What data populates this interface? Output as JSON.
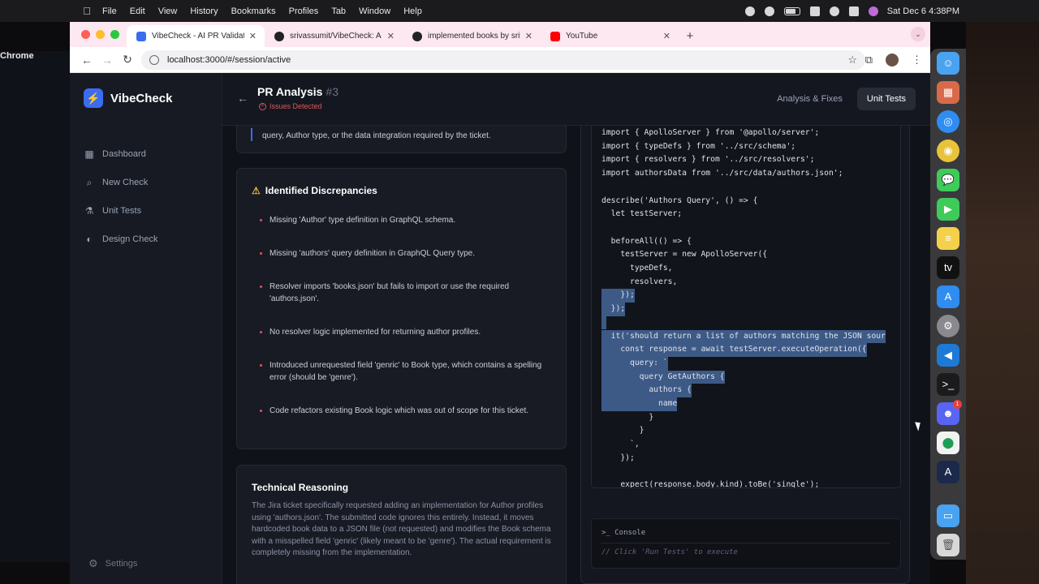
{
  "menubar": {
    "items": [
      "Chrome",
      "File",
      "Edit",
      "View",
      "History",
      "Bookmarks",
      "Profiles",
      "Tab",
      "Window",
      "Help"
    ],
    "clock": "Sat Dec 6  4:38PM"
  },
  "browser": {
    "tabs": [
      {
        "title": "VibeCheck - AI PR Validator",
        "favicon_color": "#3b6cf0"
      },
      {
        "title": "srivassumit/VibeCheck: A \"vib",
        "favicon_color": "#222222"
      },
      {
        "title": "implemented books by srivas",
        "favicon_color": "#222222"
      },
      {
        "title": "YouTube",
        "favicon_color": "#ff0000"
      }
    ],
    "url": "localhost:3000/#/session/active"
  },
  "sidebar": {
    "brand": "VibeCheck",
    "items": [
      {
        "label": "Dashboard",
        "icon": "grid-icon"
      },
      {
        "label": "New Check",
        "icon": "search-icon"
      },
      {
        "label": "Unit Tests",
        "icon": "flask-icon"
      },
      {
        "label": "Design Check",
        "icon": "palette-icon"
      }
    ],
    "settings": "Settings"
  },
  "header": {
    "title": "PR Analysis",
    "number": "#3",
    "badge": "Issues Detected",
    "tabs": [
      "Analysis & Fixes",
      "Unit Tests"
    ],
    "active_tab": "Unit Tests"
  },
  "summary_card": {
    "text": "query, Author type, or the data integration required by the ticket."
  },
  "discrepancies": {
    "title": "Identified Discrepancies",
    "items": [
      "Missing 'Author' type definition in GraphQL schema.",
      "Missing 'authors' query definition in GraphQL Query type.",
      "Resolver imports 'books.json' but fails to import or use the required 'authors.json'.",
      "No resolver logic implemented for returning author profiles.",
      "Introduced unrequested field 'genric' to Book type, which contains a spelling error (should be 'genre').",
      "Code refactors existing Book logic which was out of scope for this ticket."
    ]
  },
  "technical_reasoning": {
    "title": "Technical Reasoning",
    "body": "The Jira ticket specifically requested adding an implementation for Author profiles using 'authors.json'. The submitted code ignores this entirely. Instead, it moves hardcoded book data to a JSON file (not requested) and modifies the Book schema with a misspelled field 'genric' (likely meant to be 'genre'). The actual requirement is completely missing from the implementation."
  },
  "code": {
    "lines": [
      "import { ApolloServer } from '@apollo/server';",
      "import { typeDefs } from '../src/schema';",
      "import { resolvers } from '../src/resolvers';",
      "import authorsData from '../src/data/authors.json';",
      "",
      "describe('Authors Query', () => {",
      "  let testServer;",
      "",
      "  beforeAll(() => {",
      "    testServer = new ApolloServer({",
      "      typeDefs,",
      "      resolvers,",
      "    });",
      "  });",
      "",
      "  it('should return a list of authors matching the JSON sour",
      "    const response = await testServer.executeOperation({",
      "      query: `",
      "        query GetAuthors {",
      "          authors {",
      "            name",
      "          }",
      "        }",
      "      `,",
      "    });",
      "",
      "    expect(response.body.kind).toBe('single');"
    ],
    "selection_color": "#3d5a87"
  },
  "console": {
    "title": ">_ Console",
    "hint": "// Click 'Run Tests' to execute"
  }
}
